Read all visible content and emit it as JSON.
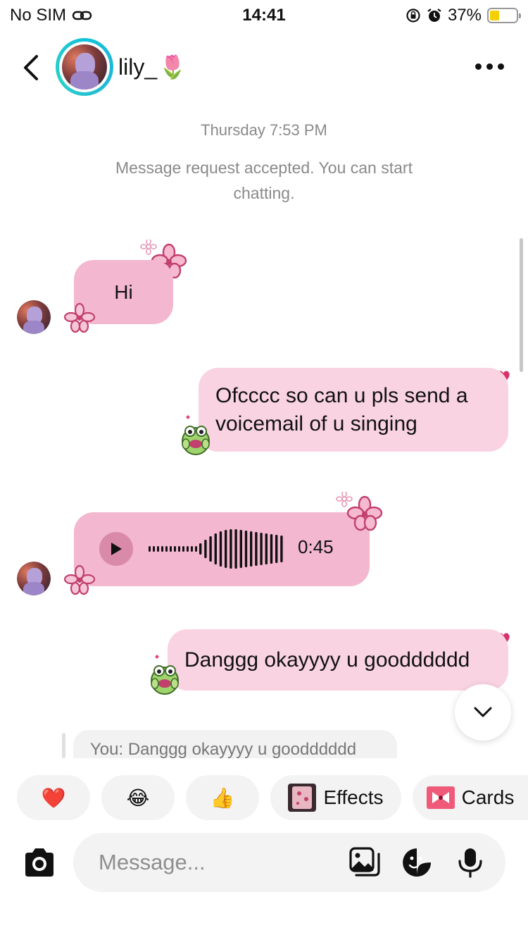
{
  "status_bar": {
    "carrier": "No SIM",
    "time": "14:41",
    "battery_percent_text": "37%",
    "battery_level": 0.37
  },
  "header": {
    "username": "lily_",
    "username_emoji": "🌷",
    "back_icon": "chevron-left-icon",
    "more_icon": "more-horizontal-icon"
  },
  "thread": {
    "timestamp": "Thursday 7:53 PM",
    "notice": "Message request accepted. You can start chatting."
  },
  "messages": [
    {
      "sender": "them",
      "text": "Hi"
    },
    {
      "sender": "me",
      "text": "Ofcccc so can u pls send a voicemail of u singing"
    },
    {
      "sender": "them",
      "type": "voice",
      "duration": "0:45"
    },
    {
      "sender": "me",
      "text": "Danggg okayyyy u goodddddd"
    }
  ],
  "preview": {
    "text": "You: Danggg okayyyy u goodddddd"
  },
  "quick_actions": [
    {
      "icon": "heart-emoji",
      "label": "❤️"
    },
    {
      "icon": "laughing-emoji",
      "label": "😂"
    },
    {
      "icon": "thumbs-up-emoji",
      "label": "👍"
    },
    {
      "icon": "effects-thumbnail",
      "label": "Effects"
    },
    {
      "icon": "bow-card-icon",
      "label": "Cards"
    }
  ],
  "composer": {
    "placeholder": "Message...",
    "camera_icon": "camera-icon",
    "gallery_icon": "gallery-icon",
    "sticker_icon": "sticker-icon",
    "mic_icon": "microphone-icon"
  },
  "colors": {
    "incoming_bubble": "#f3b7cf",
    "outgoing_bubble": "#f9d3e2",
    "avatar_ring": "#14c3d9",
    "deco_flower": "#c2406e"
  }
}
